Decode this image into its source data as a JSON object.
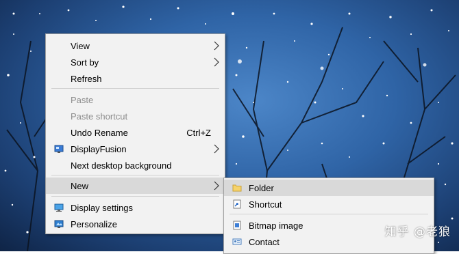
{
  "context_menu": {
    "items": [
      {
        "label": "View"
      },
      {
        "label": "Sort by"
      },
      {
        "label": "Refresh"
      },
      {
        "label": "Paste"
      },
      {
        "label": "Paste shortcut"
      },
      {
        "label": "Undo Rename",
        "shortcut": "Ctrl+Z"
      },
      {
        "label": "DisplayFusion"
      },
      {
        "label": "Next desktop background"
      },
      {
        "label": "New"
      },
      {
        "label": "Display settings"
      },
      {
        "label": "Personalize"
      }
    ]
  },
  "new_submenu": {
    "items": [
      {
        "label": "Folder"
      },
      {
        "label": "Shortcut"
      },
      {
        "label": "Bitmap image"
      },
      {
        "label": "Contact"
      }
    ]
  },
  "watermark": "知乎 @老狼",
  "icons": {
    "submenu_arrow": "chevron-right-icon",
    "displayfusion": "displayfusion-icon",
    "display_settings": "monitor-icon",
    "personalize": "personalize-icon",
    "folder": "folder-icon",
    "shortcut": "shortcut-icon",
    "bitmap": "bitmap-icon",
    "contact": "contact-card-icon"
  },
  "colors": {
    "menu_bg": "#f2f2f2",
    "highlight": "#d9d9d9",
    "disabled_text": "#8c8c8c",
    "desktop": "#2f64a6"
  }
}
